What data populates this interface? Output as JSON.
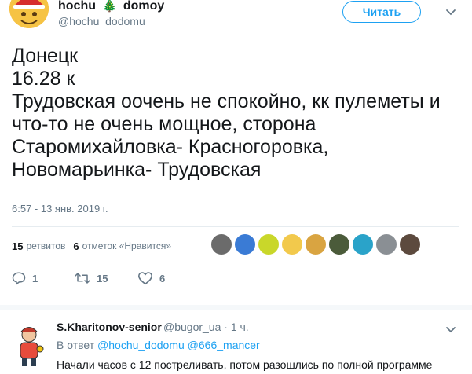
{
  "tweet": {
    "author": {
      "display_name_part1": "hochu",
      "display_name_emoji": "🎄",
      "display_name_part2": "domoy",
      "handle": "@hochu_dodomu",
      "avatar_icon": "smiley-santa-icon"
    },
    "follow_label": "Читать",
    "text": "Донецк\n16.28 к\nТрудовская оочень не спокойно, кк пулеметы и что-то не очень мощное, сторона Старомихайловка- Красногоровка, Новомарьинка- Трудовская",
    "timestamp": "6:57 - 13 янв. 2019 г.",
    "stats": {
      "retweets_count": "15",
      "retweets_label": "ретвитов",
      "likes_count": "6",
      "likes_label": "отметок «Нравится»"
    },
    "likers": [
      {
        "color": "#6b6b6b"
      },
      {
        "color": "#3a7bd5"
      },
      {
        "color": "#c9d72a"
      },
      {
        "color": "#f2c94c"
      },
      {
        "color": "#d9a441"
      },
      {
        "color": "#4b5b3a"
      },
      {
        "color": "#2aa3c9"
      },
      {
        "color": "#8a8f94"
      },
      {
        "color": "#5c4a3e"
      }
    ],
    "actions": {
      "replies": "1",
      "retweets": "15",
      "likes": "6"
    }
  },
  "reply": {
    "display_name": "S.Kharitonov-senior",
    "handle": "@bugor_ua",
    "time": "· 1 ч.",
    "in_reply_prefix": "В ответ",
    "reply_to_1": "@hochu_dodomu",
    "reply_to_2": "@666_mancer",
    "text": "Начали часов с 12 постреливать, потом разошлись по полной программе"
  },
  "colors": {
    "accent": "#1da1f2",
    "muted": "#657786",
    "text": "#14171a"
  }
}
